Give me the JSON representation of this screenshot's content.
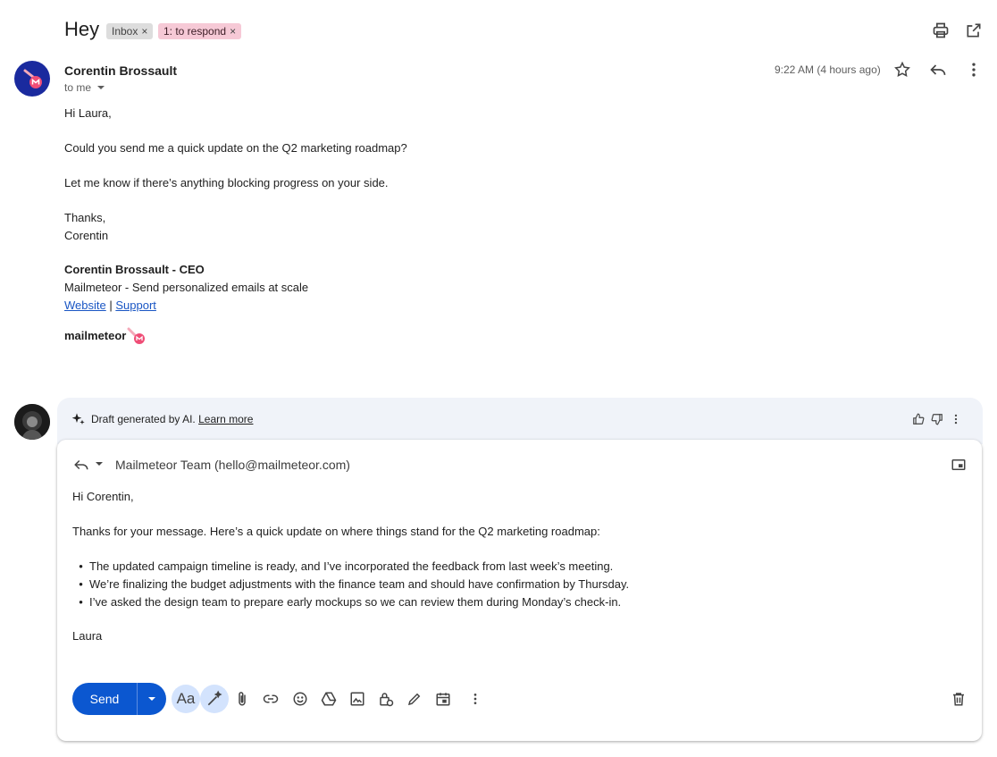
{
  "header": {
    "subject": "Hey",
    "labels": [
      {
        "text": "Inbox",
        "remove": "×"
      },
      {
        "text": "1: to respond",
        "remove": "×"
      }
    ]
  },
  "message": {
    "sender": "Corentin Brossault",
    "to": "to me",
    "time": "9:22 AM (4 hours ago)",
    "greeting": "Hi Laura,",
    "para1": "Could you send me a quick update on the Q2 marketing roadmap?",
    "para2": "Let me know if there’s anything blocking progress on your side.",
    "thanks": "Thanks,",
    "signoff": "Corentin",
    "signature": {
      "name": "Corentin Brossault - CEO",
      "tagline": "Mailmeteor - Send personalized emails at scale",
      "link1": "Website",
      "sep": "|",
      "link2": "Support",
      "logo": "mailmeteor"
    }
  },
  "draft": {
    "ai_text": "Draft generated by AI.",
    "learn_more": "Learn more",
    "from": "Mailmeteor Team (hello@mailmeteor.com)",
    "greeting": "Hi Corentin,",
    "intro": "Thanks for your message. Here’s a quick update on where things stand for the Q2 marketing roadmap:",
    "bullets": [
      "The updated campaign timeline is ready, and I’ve incorporated the feedback from last week’s meeting.",
      "We’re finalizing the budget adjustments with the finance team and should have confirmation by Thursday.",
      "I’ve asked the design team to prepare early mockups so we can review them during Monday’s check-in."
    ],
    "signoff": "Laura",
    "send_label": "Send",
    "format_label": "Aa"
  },
  "colors": {
    "accent": "#0b57d0",
    "respond_label": "#f6c9d6"
  }
}
